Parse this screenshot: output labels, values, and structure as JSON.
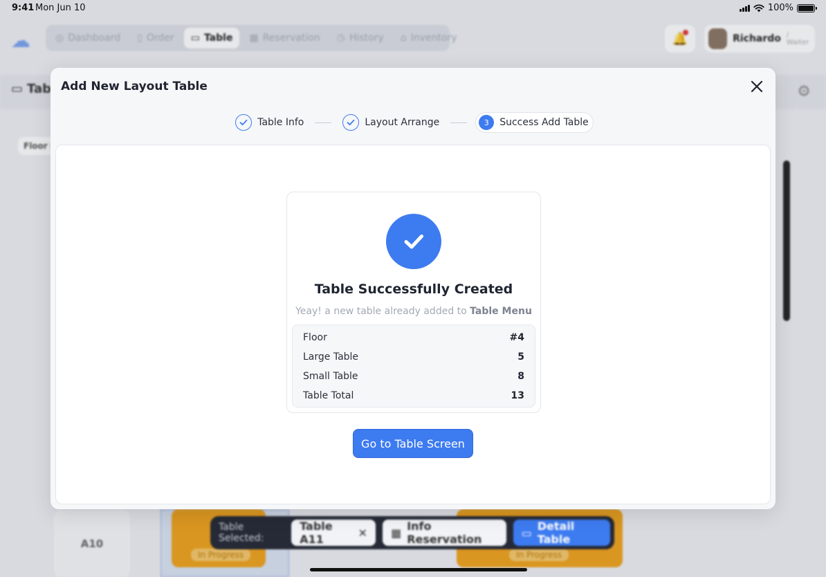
{
  "status_bar": {
    "time": "9:41",
    "date": "Mon Jun 10",
    "battery": "100%"
  },
  "background": {
    "nav_tabs": [
      {
        "label": "Dashboard",
        "icon": "dashboard-icon"
      },
      {
        "label": "Order",
        "icon": "order-icon"
      },
      {
        "label": "Table",
        "icon": "monitor-icon",
        "active": true
      },
      {
        "label": "Reservation",
        "icon": "calendar-icon"
      },
      {
        "label": "History",
        "icon": "clock-icon"
      },
      {
        "label": "Inventory",
        "icon": "store-icon"
      }
    ],
    "user_name": "Richardo",
    "user_role": "/ Waiter",
    "page_title": "Tab",
    "floor_label": "Floor I",
    "table_a10": "A10",
    "status_pill": "In Progress"
  },
  "action_bar": {
    "label": "Table Selected:",
    "selected_table": "Table A11",
    "info_button": "Info Reservation",
    "detail_button": "Detail Table"
  },
  "modal": {
    "title": "Add New Layout Table",
    "steps": [
      {
        "label": "Table Info",
        "state": "done"
      },
      {
        "label": "Layout Arrange",
        "state": "done"
      },
      {
        "label": "Success Add Table",
        "state": "current",
        "number": "3"
      }
    ],
    "success": {
      "title": "Table Successfully Created",
      "subtitle_prefix": "Yeay! a new table already added to ",
      "subtitle_bold": "Table Menu"
    },
    "summary": [
      {
        "label": "Floor",
        "value": "#4"
      },
      {
        "label": "Large Table",
        "value": "5"
      },
      {
        "label": "Small Table",
        "value": "8"
      },
      {
        "label": "Table Total",
        "value": "13"
      }
    ],
    "cta_label": "Go to Table Screen"
  },
  "colors": {
    "primary": "#3d7bf0",
    "warning": "#f0a21a",
    "dark": "#262a36"
  }
}
